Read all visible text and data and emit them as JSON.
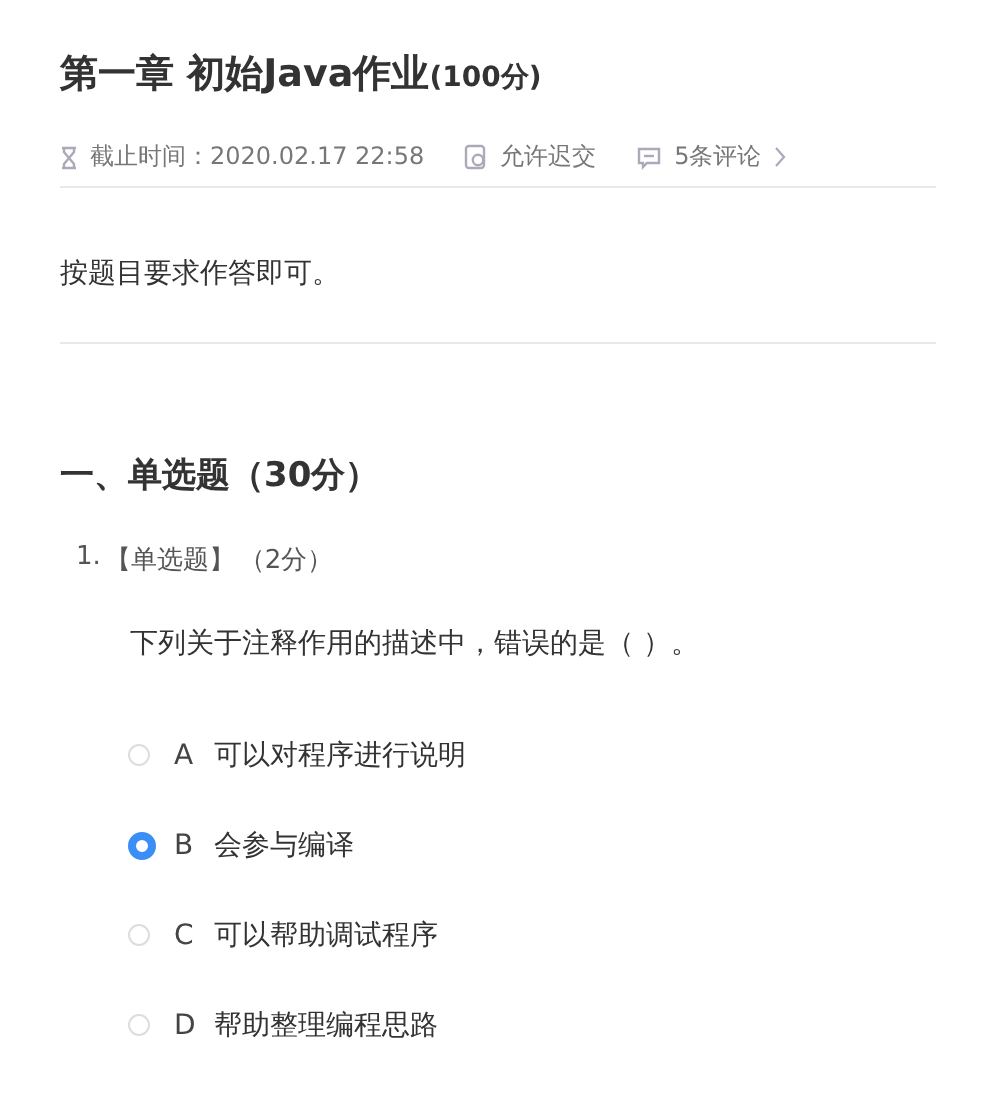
{
  "assignment": {
    "title": "第一章 初始Java作业",
    "score": "(100分)"
  },
  "meta": [
    {
      "kind": "deadline",
      "text": "截止时间：2020.02.17 22:58"
    },
    {
      "kind": "late",
      "text": "允许迟交"
    },
    {
      "kind": "comments",
      "text": "5条评论"
    }
  ],
  "description": "按题目要求作答即可。",
  "section": {
    "title": "一、单选题（30分）"
  },
  "question": {
    "number": "1.",
    "type": "【单选题】",
    "points": "（2分）",
    "text": "下列关于注释作用的描述中，错误的是（ ）。",
    "options": [
      {
        "letter": "A",
        "text": "可以对程序进行说明",
        "selected": false
      },
      {
        "letter": "B",
        "text": "会参与编译",
        "selected": true
      },
      {
        "letter": "C",
        "text": "可以帮助调试程序",
        "selected": false
      },
      {
        "letter": "D",
        "text": "帮助整理编程思路",
        "selected": false
      }
    ]
  }
}
